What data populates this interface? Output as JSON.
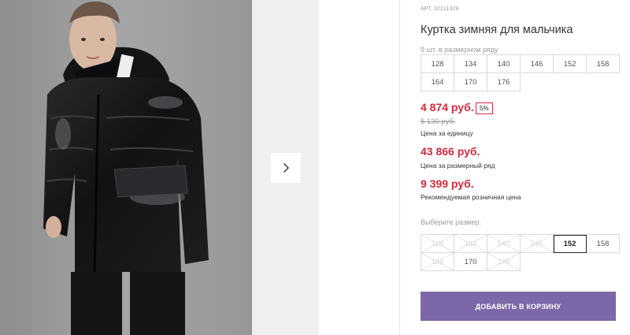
{
  "product": {
    "article_label": "АРТ.",
    "article_value": "32211329",
    "title": "Куртка зимняя для мальчика"
  },
  "pack": {
    "note": "9 шт. в размерном ряду",
    "sizes": [
      "128",
      "134",
      "140",
      "146",
      "152",
      "158",
      "164",
      "170",
      "176"
    ]
  },
  "prices": {
    "unit_price": "4 874 руб.",
    "discount": "5%",
    "old_price": "5 130 руб.",
    "unit_note": "Цена за единицу",
    "pack_price": "43 866 руб.",
    "pack_note": "Цена за размерный ряд",
    "retail_price": "9 399 руб.",
    "retail_note": "Рекомендуемая розничная цена"
  },
  "size_picker": {
    "label": "Выберите размер:",
    "options": [
      {
        "label": "128",
        "state": "disabled"
      },
      {
        "label": "134",
        "state": "disabled"
      },
      {
        "label": "140",
        "state": "disabled"
      },
      {
        "label": "146",
        "state": "disabled"
      },
      {
        "label": "152",
        "state": "selected"
      },
      {
        "label": "158",
        "state": "available"
      },
      {
        "label": "164",
        "state": "disabled"
      },
      {
        "label": "170",
        "state": "available"
      },
      {
        "label": "176",
        "state": "disabled"
      }
    ]
  },
  "cart": {
    "add_label": "ДОБАВИТЬ В КОРЗИНУ"
  },
  "colors": {
    "price": "#d52b3e",
    "button": "#7c67a8"
  },
  "icons": {
    "next": "chevron-right-icon"
  }
}
